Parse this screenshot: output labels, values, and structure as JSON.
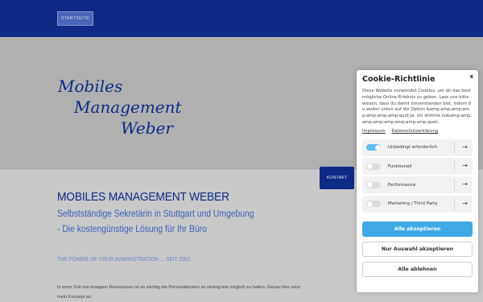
{
  "nav": {
    "home_label": "STARTSEITE"
  },
  "logo": {
    "line1": "Mobiles",
    "line2": "Management",
    "line3": "Weber"
  },
  "contact_tab": "KONTAKT",
  "content": {
    "title": "MOBILES MANAGEMENT WEBER",
    "subtitle1": "Selbstständige Sekretärin in Stuttgart und Umgebung",
    "subtitle2": "- Die kostengünstige Lösung für Ihr Büro",
    "tagline": "THE POWER OF YOUR ADMINISTRATION ... SEIT 2002",
    "body": "In einer Zeit von knappen Ressourcen ist es wichtig die Personalkosten so niedrig wie möglich zu halten. Genau hier setzt mein Konzept an."
  },
  "cookie": {
    "title": "Cookie-Richtlinie",
    "close": "x",
    "text": "Diese Website verwendet Cookies, um dir das bestmögliche Online-Erlebnis zu geben. Lass uns bitte wissen, dass du damit einverstanden bist, indem du weiter unten auf die Option &amp;amp;amp;amp;amp;amp;amp;quot;Ja, ich stimme zu&amp;amp;amp;amp;amp;amp;amp;amp;quot;",
    "link_impressum": "Impressum",
    "link_datenschutz": "Datenschutzerklärung",
    "toggles": [
      {
        "label": "Unbedingt erforderlich",
        "on": true
      },
      {
        "label": "Funktionell",
        "on": false
      },
      {
        "label": "Performance",
        "on": false
      },
      {
        "label": "Marketing / Third Party",
        "on": false
      }
    ],
    "arrow": "→",
    "accept_all": "Alle akzeptieren",
    "accept_selection": "Nur Auswahl akzeptieren",
    "reject_all": "Alle ablehnen",
    "accent_color": "#3fa9e6"
  },
  "colors": {
    "brand": "#0d2a86",
    "accent": "#3b5fb5"
  }
}
